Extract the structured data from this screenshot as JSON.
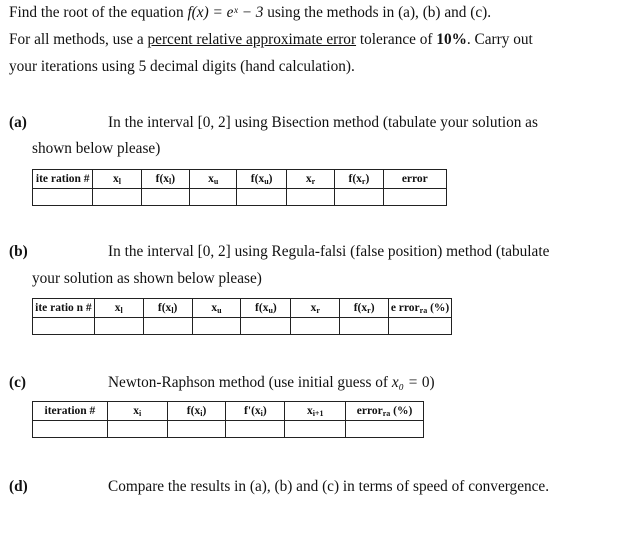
{
  "intro": {
    "line1_pre": "Find the root of the equation ",
    "equation": "f(x) = eˣ − 3",
    "line1_post": " using the methods in (a), (b) and (c).",
    "line2_pre": "For all methods, use a ",
    "line2_underlined": "percent relative approximate error",
    "line2_mid": " tolerance of ",
    "line2_bold": "10%",
    "line2_post": ". Carry out",
    "line3": "your iterations using 5 decimal digits (hand calculation)."
  },
  "parts": {
    "a": {
      "label": "(a)",
      "text1": "In the interval [0, 2] using Bisection method (tabulate your solution as",
      "text2": "shown below please)",
      "table": {
        "headers": [
          {
            "main": "ite ration #",
            "sub": ""
          },
          {
            "main": "x",
            "sub": "l"
          },
          {
            "main": "f(x",
            "sub": "l",
            "tail": ")"
          },
          {
            "main": "x",
            "sub": "u"
          },
          {
            "main": "f(x",
            "sub": "u",
            "tail": ")"
          },
          {
            "main": "x",
            "sub": "r"
          },
          {
            "main": "f(x",
            "sub": "r",
            "tail": ")"
          },
          {
            "main": "error",
            "sub": ""
          }
        ]
      }
    },
    "b": {
      "label": "(b)",
      "text1": "In the interval [0, 2] using Regula-falsi (false position) method (tabulate",
      "text2": "your solution as shown below please)",
      "table": {
        "headers": [
          {
            "main": "ite ratio n #",
            "sub": ""
          },
          {
            "main": "x",
            "sub": "l"
          },
          {
            "main": "f(x",
            "sub": "l",
            "tail": ")"
          },
          {
            "main": "x",
            "sub": "u"
          },
          {
            "main": "f(x",
            "sub": "u",
            "tail": ")"
          },
          {
            "main": "x",
            "sub": "r"
          },
          {
            "main": "f(x",
            "sub": "r",
            "tail": ")"
          },
          {
            "main": "e rror",
            "sub": "ra",
            "tail": " (%)"
          }
        ]
      }
    },
    "c": {
      "label": "(c)",
      "text1_pre": "Newton-Raphson method (use initial guess of ",
      "text1_math": "x₀ = ",
      "text1_post": " 0)",
      "table": {
        "headers": [
          {
            "main": "iteration #",
            "sub": ""
          },
          {
            "main": "x",
            "sub": "i"
          },
          {
            "main": "f(x",
            "sub": "i",
            "tail": ")"
          },
          {
            "main": "f'(x",
            "sub": "i",
            "tail": ")"
          },
          {
            "main": "x",
            "sub": "i+1"
          },
          {
            "main": "error",
            "sub": "ra",
            "tail": " (%)"
          }
        ]
      }
    },
    "d": {
      "label": "(d)",
      "text1": "Compare the results in (a), (b) and (c) in terms of speed of convergence."
    }
  }
}
